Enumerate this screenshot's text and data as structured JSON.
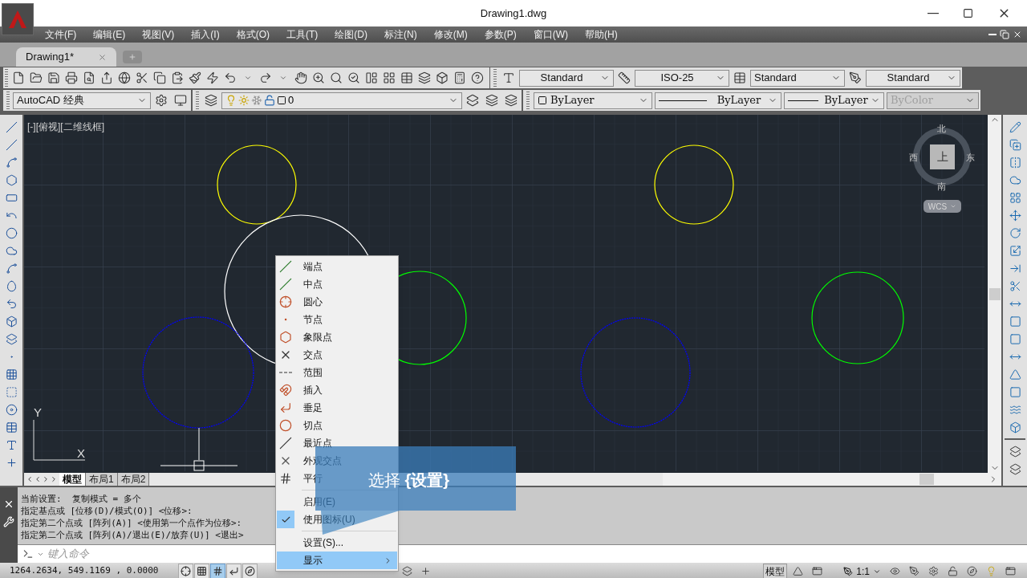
{
  "window": {
    "title": "Drawing1.dwg"
  },
  "menu_bar": [
    "文件(F)",
    "编辑(E)",
    "视图(V)",
    "插入(I)",
    "格式(O)",
    "工具(T)",
    "绘图(D)",
    "标注(N)",
    "修改(M)",
    "参数(P)",
    "窗口(W)",
    "帮助(H)"
  ],
  "doc_tabs": [
    {
      "label": "Drawing1*",
      "selected": true
    }
  ],
  "styles_toolbar": {
    "text_style": "Standard",
    "dim_style": "ISO-25",
    "table_style": "Standard",
    "multileader_style": "Standard"
  },
  "layers_toolbar": {
    "workspace": "AutoCAD 经典",
    "layer": "0",
    "color_control": "ByLayer",
    "linetype": "ByLayer",
    "lineweight": "ByLayer",
    "plot_style": {
      "value": "ByColor",
      "disabled": true
    }
  },
  "viewport": {
    "label": "[-][俯视][二维线框]"
  },
  "viewcube": {
    "north": "北",
    "south": "南",
    "west": "西",
    "east": "东",
    "face": "上",
    "ucs_menu": "WCS"
  },
  "ucs_icon": {
    "x": "X",
    "y": "Y"
  },
  "circles": [
    {
      "color": "#ffff00"
    },
    {
      "color": "#ffff00"
    },
    {
      "color": "#ffffff"
    },
    {
      "color": "#00ff00"
    },
    {
      "color": "#00ff00"
    },
    {
      "color": "#0000ff"
    },
    {
      "color": "#0000ff"
    }
  ],
  "layout_tabs": [
    {
      "label": "模型",
      "selected": true
    },
    {
      "label": "布局1",
      "selected": false
    },
    {
      "label": "布局2",
      "selected": false
    }
  ],
  "command_history": [
    "当前设置:  复制模式 = 多个",
    "指定基点或 [位移(D)/模式(O)] <位移>:",
    "指定第二个点或 [阵列(A)] <使用第一个点作为位移>:",
    "指定第二个点或 [阵列(A)/退出(E)/放弃(U)] <退出>"
  ],
  "command_input": {
    "placeholder": "键入命令"
  },
  "status_bar": {
    "coordinates": "1264.2634, 549.1169 , 0.0000",
    "toggles": [
      {
        "on": false
      },
      {
        "on": false
      },
      {
        "on": true
      },
      {
        "on": false
      },
      {
        "on": false
      }
    ],
    "model_label": "模型",
    "annotation_scale": "1:1"
  },
  "context_menu": {
    "items": [
      {
        "kind": "snap",
        "label": "端点",
        "checked": false,
        "selected": false
      },
      {
        "kind": "snap",
        "label": "中点",
        "checked": false,
        "selected": false
      },
      {
        "kind": "snap",
        "label": "圆心",
        "checked": false,
        "selected": false
      },
      {
        "kind": "snap",
        "label": "节点",
        "checked": false,
        "selected": false
      },
      {
        "kind": "snap",
        "label": "象限点",
        "checked": false,
        "selected": false
      },
      {
        "kind": "snap",
        "label": "交点",
        "checked": false,
        "selected": false
      },
      {
        "kind": "snap",
        "label": "范围",
        "checked": false,
        "selected": false
      },
      {
        "kind": "snap",
        "label": "插入",
        "checked": false,
        "selected": false
      },
      {
        "kind": "snap",
        "label": "垂足",
        "checked": false,
        "selected": false
      },
      {
        "kind": "snap",
        "label": "切点",
        "checked": false,
        "selected": false
      },
      {
        "kind": "snap",
        "label": "最近点",
        "checked": false,
        "selected": false
      },
      {
        "kind": "snap",
        "label": "外观交点",
        "checked": false,
        "selected": false
      },
      {
        "kind": "snap",
        "label": "平行",
        "checked": false,
        "selected": false
      },
      {
        "kind": "separator"
      },
      {
        "kind": "toggle",
        "label": "启用(E)",
        "checked": false,
        "selected": false
      },
      {
        "kind": "toggle",
        "label": "使用图标(U)",
        "checked": true,
        "selected": false
      },
      {
        "kind": "separator"
      },
      {
        "kind": "action",
        "label": "设置(S)...",
        "checked": false,
        "selected": false
      },
      {
        "kind": "submenu",
        "label": "显示",
        "checked": false,
        "selected": true
      }
    ]
  },
  "callout": {
    "text": "选择 **{设置}**"
  }
}
